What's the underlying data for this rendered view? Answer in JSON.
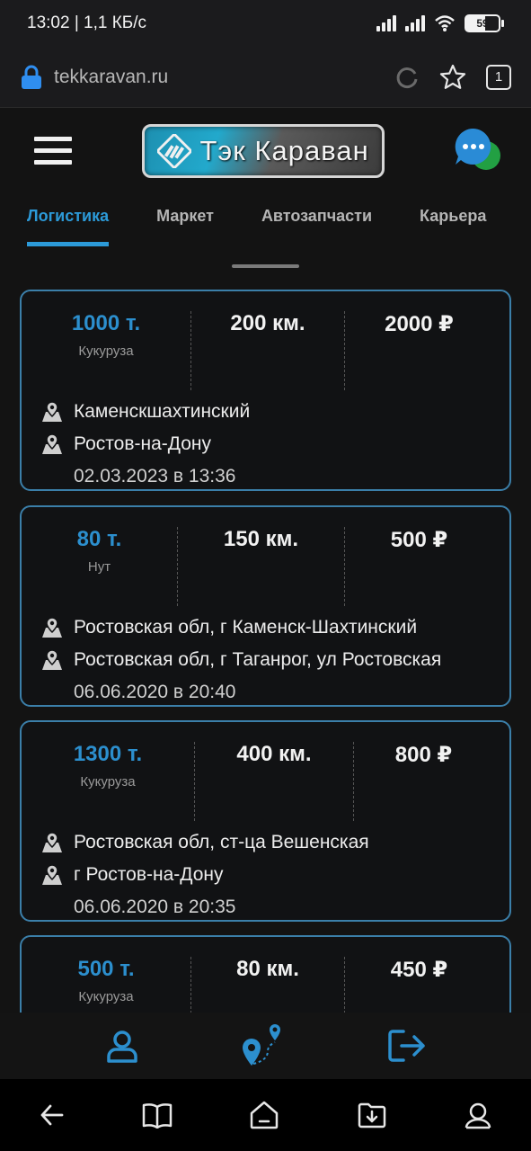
{
  "status_bar": {
    "time_speed": "13:02 | 1,1 КБ/с",
    "battery": "59"
  },
  "browser": {
    "url": "tekkaravan.ru",
    "tabs_count": "1"
  },
  "header": {
    "logo_text": "Тэк Караван"
  },
  "nav": {
    "tabs": [
      {
        "label": "Логистика",
        "active": true
      },
      {
        "label": "Маркет",
        "active": false
      },
      {
        "label": "Автозапчасти",
        "active": false
      },
      {
        "label": "Карьера",
        "active": false
      }
    ]
  },
  "orders": [
    {
      "weight": "1000 т.",
      "cargo": "Кукуруза",
      "distance": "200 км.",
      "price": "2000 ₽",
      "from": "Каменскшахтинский",
      "to": "Ростов-на-Дону",
      "date": "02.03.2023 в 13:36"
    },
    {
      "weight": "80 т.",
      "cargo": "Нут",
      "distance": "150 км.",
      "price": "500 ₽",
      "from": "Ростовская обл, г Каменск-Шахтинский",
      "to": "Ростовская обл, г Таганрог, ул Ростовская",
      "date": "06.06.2020 в 20:40"
    },
    {
      "weight": "1300 т.",
      "cargo": "Кукуруза",
      "distance": "400 км.",
      "price": "800 ₽",
      "from": "Ростовская обл, ст-ца Вешенская",
      "to": "г Ростов-на-Дону",
      "date": "06.06.2020 в 20:35"
    },
    {
      "weight": "500 т.",
      "cargo": "Кукуруза",
      "distance": "80 км.",
      "price": "450 ₽",
      "from": "",
      "to": "",
      "date": ""
    }
  ],
  "colors": {
    "accent": "#2c9ad8",
    "card_border": "#3b7fa9",
    "background": "#131313"
  },
  "icons": {
    "bottom_bar": [
      "profile-icon",
      "route-map-icon",
      "logout-icon"
    ],
    "android_nav": [
      "back-icon",
      "bookmarks-icon",
      "home-icon",
      "downloads-icon",
      "account-icon"
    ]
  }
}
